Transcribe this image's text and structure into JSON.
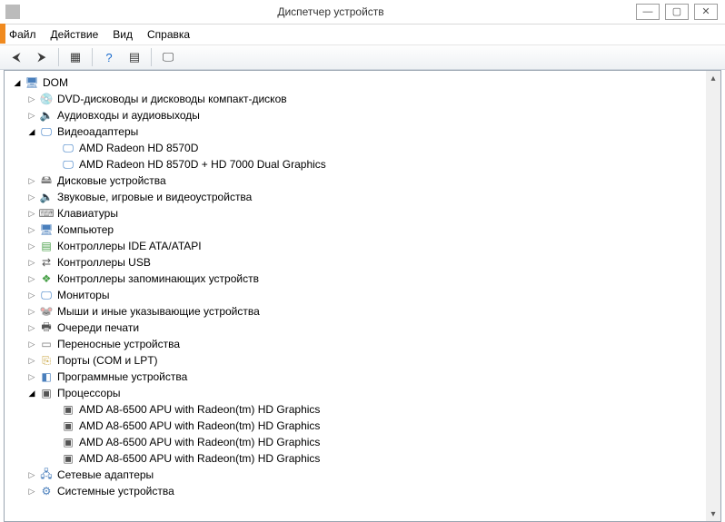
{
  "window": {
    "title": "Диспетчер устройств"
  },
  "menubar": [
    "Файл",
    "Действие",
    "Вид",
    "Справка"
  ],
  "tree": {
    "root": {
      "label": "DOM",
      "expanded": true,
      "icon": "computer-icon"
    },
    "children": [
      {
        "label": "DVD-дисководы и дисководы компакт-дисков",
        "expanded": false,
        "icon": "disc-icon",
        "hasChildren": true
      },
      {
        "label": "Аудиовходы и аудиовыходы",
        "expanded": false,
        "icon": "audio-icon",
        "hasChildren": true
      },
      {
        "label": "Видеоадаптеры",
        "expanded": true,
        "icon": "display-icon",
        "hasChildren": true,
        "children": [
          {
            "label": "AMD Radeon HD 8570D",
            "icon": "display-icon"
          },
          {
            "label": "AMD Radeon HD 8570D + HD 7000 Dual Graphics",
            "icon": "display-icon"
          }
        ]
      },
      {
        "label": "Дисковые устройства",
        "expanded": false,
        "icon": "drive-icon",
        "hasChildren": true
      },
      {
        "label": "Звуковые, игровые и видеоустройства",
        "expanded": false,
        "icon": "audio-icon",
        "hasChildren": true
      },
      {
        "label": "Клавиатуры",
        "expanded": false,
        "icon": "keyboard-icon",
        "hasChildren": true
      },
      {
        "label": "Компьютер",
        "expanded": false,
        "icon": "computer-icon",
        "hasChildren": true
      },
      {
        "label": "Контроллеры IDE ATA/ATAPI",
        "expanded": false,
        "icon": "ide-icon",
        "hasChildren": true
      },
      {
        "label": "Контроллеры USB",
        "expanded": false,
        "icon": "usb-icon",
        "hasChildren": true
      },
      {
        "label": "Контроллеры запоминающих устройств",
        "expanded": false,
        "icon": "storage-icon",
        "hasChildren": true
      },
      {
        "label": "Мониторы",
        "expanded": false,
        "icon": "monitor-icon",
        "hasChildren": true
      },
      {
        "label": "Мыши и иные указывающие устройства",
        "expanded": false,
        "icon": "mouse-icon",
        "hasChildren": true
      },
      {
        "label": "Очереди печати",
        "expanded": false,
        "icon": "printq-icon",
        "hasChildren": true
      },
      {
        "label": "Переносные устройства",
        "expanded": false,
        "icon": "portable-icon",
        "hasChildren": true
      },
      {
        "label": "Порты (COM и LPT)",
        "expanded": false,
        "icon": "port-icon",
        "hasChildren": true
      },
      {
        "label": "Программные устройства",
        "expanded": false,
        "icon": "software-icon",
        "hasChildren": true
      },
      {
        "label": "Процессоры",
        "expanded": true,
        "icon": "cpu-icon",
        "hasChildren": true,
        "children": [
          {
            "label": "AMD A8-6500 APU with Radeon(tm) HD Graphics",
            "icon": "cpu-icon"
          },
          {
            "label": "AMD A8-6500 APU with Radeon(tm) HD Graphics",
            "icon": "cpu-icon"
          },
          {
            "label": "AMD A8-6500 APU with Radeon(tm) HD Graphics",
            "icon": "cpu-icon"
          },
          {
            "label": "AMD A8-6500 APU with Radeon(tm) HD Graphics",
            "icon": "cpu-icon"
          }
        ]
      },
      {
        "label": "Сетевые адаптеры",
        "expanded": false,
        "icon": "net-icon",
        "hasChildren": true
      },
      {
        "label": "Системные устройства",
        "expanded": false,
        "icon": "sys-icon",
        "hasChildren": true
      }
    ]
  },
  "icons": {
    "computer-icon": "🖥",
    "disc-icon": "💿",
    "audio-icon": "🔈",
    "display-icon": "🖵",
    "drive-icon": "🖴",
    "keyboard-icon": "⌨",
    "ide-icon": "▤",
    "usb-icon": "⇄",
    "storage-icon": "❖",
    "monitor-icon": "🖵",
    "mouse-icon": "🐭",
    "printq-icon": "🖶",
    "portable-icon": "▭",
    "port-icon": "⎘",
    "software-icon": "◧",
    "cpu-icon": "▣",
    "net-icon": "🖧",
    "sys-icon": "⚙"
  }
}
